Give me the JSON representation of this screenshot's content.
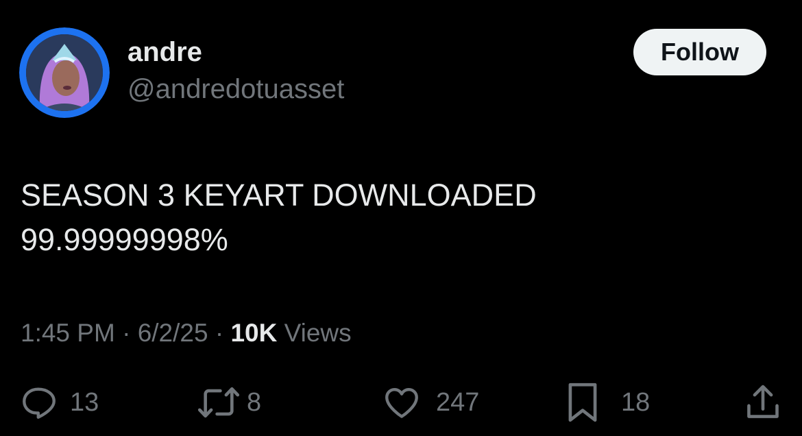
{
  "author": {
    "display_name": "andre",
    "handle": "@andredotuasset"
  },
  "follow_label": "Follow",
  "post": {
    "text": "SEASON 3 KEYART DOWNLOADED\n99.99999998%"
  },
  "meta": {
    "time": "1:45 PM",
    "separator": " · ",
    "date": "6/2/25",
    "views_count": "10K",
    "views_label": " Views"
  },
  "actions": {
    "replies": "13",
    "reposts": "8",
    "likes": "247",
    "bookmarks": "18"
  },
  "colors": {
    "background": "#000000",
    "text": "#e7e9ea",
    "muted": "#71767b",
    "follow_bg": "#eff3f4",
    "avatar_ring": "#1d72f0"
  },
  "icons": {
    "reply": "reply-icon",
    "repost": "repost-icon",
    "like": "heart-icon",
    "bookmark": "bookmark-icon",
    "share": "share-icon"
  }
}
